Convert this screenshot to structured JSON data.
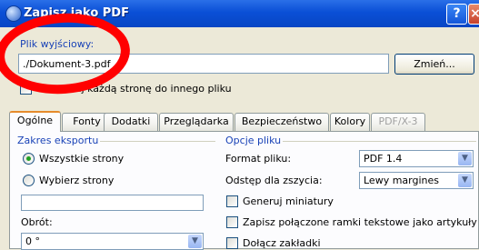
{
  "window": {
    "title": "Zapisz jako PDF",
    "help_label": "?",
    "close_label": "×"
  },
  "output": {
    "label": "Plik wyjściowy:",
    "path_value": "./Dokument-3.pdf",
    "change_button": "Zmień...",
    "export_pages_checkbox": "Eksportuj każdą stronę do innego pliku"
  },
  "tabs": [
    "Ogólne",
    "Fonty",
    "Dodatki",
    "Przeglądarka",
    "Bezpieczeństwo",
    "Kolory",
    "PDF/X-3"
  ],
  "export_range": {
    "title": "Zakres eksportu",
    "all_pages": "Wszystkie strony",
    "choose_pages": "Wybierz strony",
    "pages_value": "",
    "rotation_label": "Obrót:",
    "rotation_value": "0 °"
  },
  "file_options": {
    "title": "Opcje pliku",
    "format_label": "Format pliku:",
    "format_value": "PDF 1.4",
    "binding_label": "Odstęp dla zszycia:",
    "binding_value": "Lewy margines",
    "thumbnails": "Generuj miniatury",
    "save_frames": "Zapisz połączone ramki tekstowe jako artykuły PDF",
    "bookmarks": "Dołącz zakładki"
  },
  "colors": {
    "title_bar": "#0a4fd6",
    "accent_label": "#1a43b7",
    "annotation": "#ff0000"
  }
}
